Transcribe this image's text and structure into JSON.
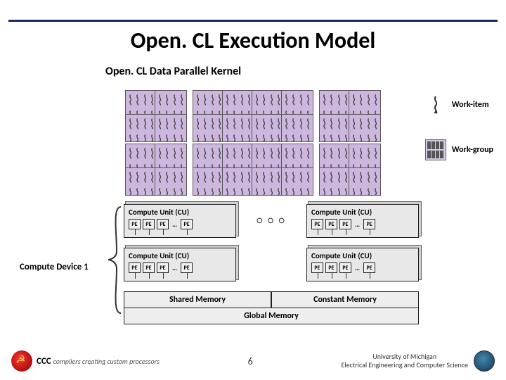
{
  "title": "Open. CL Execution Model",
  "subtitle": "Open. CL Data Parallel Kernel",
  "legend": {
    "work_item": "Work-item",
    "work_group": "Work-group"
  },
  "compute_unit_label": "Compute Unit (CU)",
  "pe_label": "PE",
  "pe_dots": "…",
  "ellipsis": "○ ○ ○",
  "memory": {
    "shared": "Shared Memory",
    "constant": "Constant Memory",
    "global": "Global Memory"
  },
  "device_label": "Compute Device 1",
  "footer": {
    "ccc_bold": "CCC",
    "ccc_tag": "compilers creating custom processors",
    "page": "6",
    "um_line1": "University of Michigan",
    "um_line2": "Electrical Engineering and Computer Science"
  }
}
